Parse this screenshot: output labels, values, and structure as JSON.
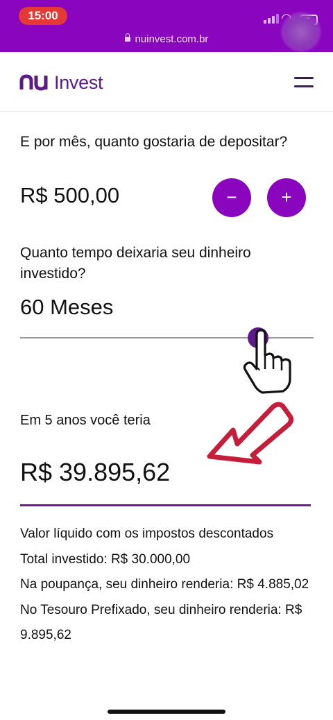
{
  "status_bar": {
    "time": "15:00"
  },
  "browser": {
    "url": "nuinvest.com.br"
  },
  "header": {
    "logo_text": "Invest",
    "menu_icon": "hamburger-icon"
  },
  "monthly_deposit": {
    "question": "E por mês, quanto gostaria de depositar?",
    "value": "R$ 500,00",
    "decrement_label": "−",
    "increment_label": "+"
  },
  "investment_time": {
    "question": "Quanto tempo deixaria seu dinheiro investido?",
    "value": "60 Meses"
  },
  "result": {
    "label": "Em 5 anos você teria",
    "value": "R$ 39.895,62"
  },
  "details": {
    "net_value": "Valor líquido com os impostos descontados",
    "total_invested": "Total investido: R$ 30.000,00",
    "savings": "Na poupança, seu dinheiro renderia: R$ 4.885,02",
    "treasury": "No Tesouro Prefixado, seu dinheiro renderia: R$ 9.895,62"
  },
  "colors": {
    "brand": "#8A05BE",
    "accent_dark": "#5D1A8A",
    "annotation_arrow": "#C41E3A"
  }
}
